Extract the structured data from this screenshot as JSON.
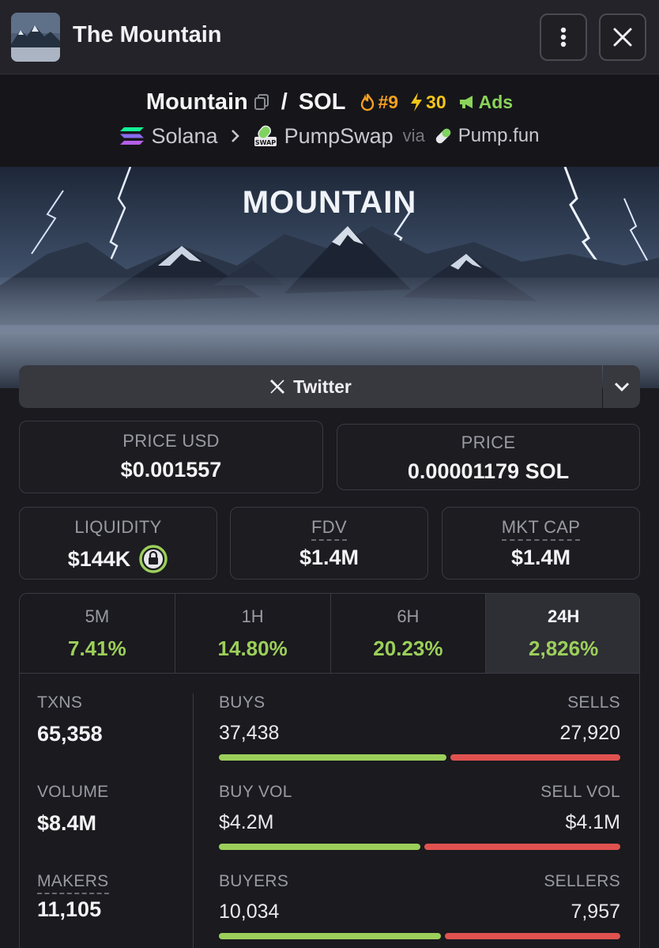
{
  "window": {
    "title": "The Mountain",
    "menu_icon": "more-vertical-icon",
    "close_icon": "close-icon"
  },
  "pair": {
    "base": "Mountain",
    "separator": "/",
    "quote": "SOL",
    "rank": "#9",
    "boosts": "30",
    "ads_label": "Ads"
  },
  "chain": {
    "name": "Solana",
    "dex": "PumpSwap",
    "via_label": "via",
    "launchpad": "Pump.fun"
  },
  "banner": {
    "text": "MOUNTAIN"
  },
  "social": {
    "twitter_label": "Twitter"
  },
  "price": {
    "usd_label": "PRICE USD",
    "usd_value": "$0.001557",
    "native_label": "PRICE",
    "native_value": "0.00001179 SOL"
  },
  "metrics": {
    "liquidity_label": "LIQUIDITY",
    "liquidity_value": "$144K",
    "fdv_label": "FDV",
    "fdv_value": "$1.4M",
    "mcap_label": "MKT CAP",
    "mcap_value": "$1.4M"
  },
  "timeframes": [
    {
      "label": "5M",
      "change": "7.41%",
      "active": false
    },
    {
      "label": "1H",
      "change": "14.80%",
      "active": false
    },
    {
      "label": "6H",
      "change": "20.23%",
      "active": false
    },
    {
      "label": "24H",
      "change": "2,826%",
      "active": true
    }
  ],
  "stats": {
    "txns_label": "TXNS",
    "txns_value": "65,358",
    "volume_label": "VOLUME",
    "volume_value": "$8.4M",
    "makers_label": "MAKERS",
    "makers_value": "11,105"
  },
  "ratios": [
    {
      "left_label": "BUYS",
      "left_value": "37,438",
      "right_label": "SELLS",
      "right_value": "27,920",
      "buy_share": 0.573
    },
    {
      "left_label": "BUY VOL",
      "left_value": "$4.2M",
      "right_label": "SELL VOL",
      "right_value": "$4.1M",
      "buy_share": 0.506
    },
    {
      "left_label": "BUYERS",
      "left_value": "10,034",
      "right_label": "SELLERS",
      "right_value": "7,957",
      "buy_share": 0.558
    }
  ],
  "colors": {
    "positive": "#9ccf5a",
    "negative": "#e0524f",
    "rank": "#f5a020",
    "boost": "#f5c518"
  }
}
